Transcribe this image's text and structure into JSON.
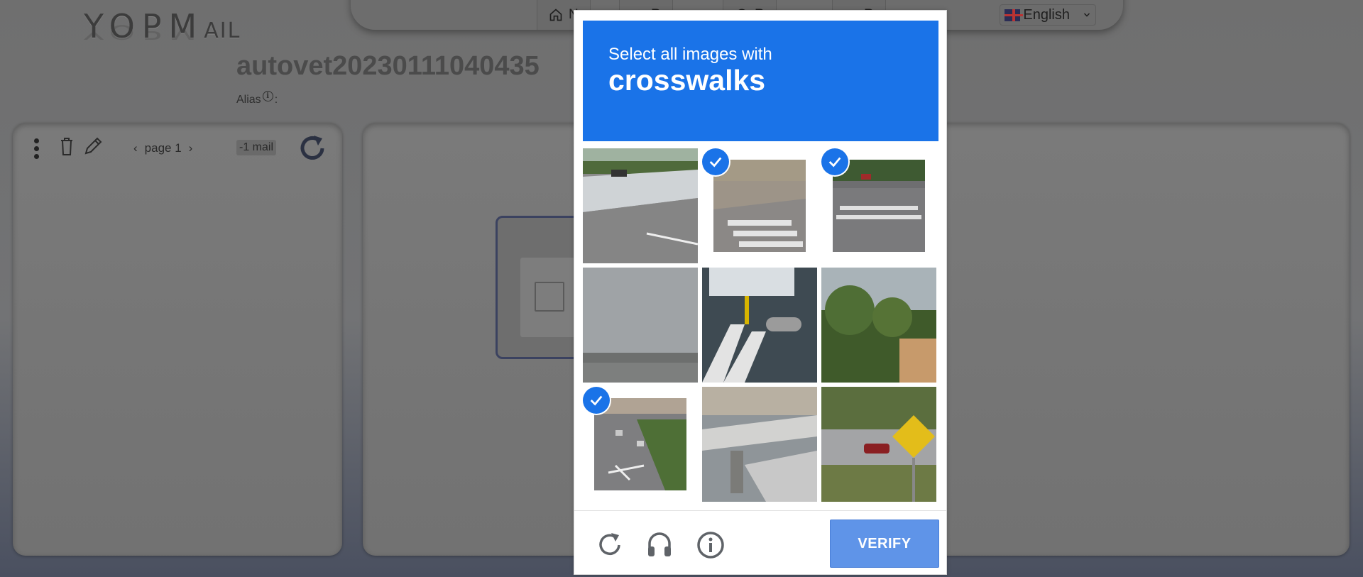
{
  "site": {
    "logo_main": "YOPM",
    "logo_tail": "AIL",
    "inbox_name": "autovet20230111040435",
    "alias_label": "Alias",
    "alias_sep": ":"
  },
  "nav": {
    "items": [
      {
        "label": "N",
        "icon": "home-icon"
      },
      {
        "label": "R",
        "icon": "back-icon"
      },
      {
        "label": "R",
        "icon": "globe-icon"
      },
      {
        "label": "R",
        "icon": "settings-icon"
      }
    ],
    "language": "English"
  },
  "inbox_toolbar": {
    "page_label": "page 1",
    "mail_count": "-1 mail"
  },
  "captcha": {
    "prompt": "Select all images with",
    "target": "crosswalks",
    "verify_label": "VERIFY",
    "accent_color": "#1a73e8",
    "tiles": [
      {
        "selected": false,
        "scene": "highway with wall"
      },
      {
        "selected": true,
        "scene": "crosswalk on road"
      },
      {
        "selected": true,
        "scene": "street with crosswalk"
      },
      {
        "selected": false,
        "scene": "cloudy sky"
      },
      {
        "selected": false,
        "scene": "crosswalk near bus"
      },
      {
        "selected": false,
        "scene": "palm trees"
      },
      {
        "selected": true,
        "scene": "road with traffic"
      },
      {
        "selected": false,
        "scene": "overpass"
      },
      {
        "selected": false,
        "scene": "road sign"
      }
    ]
  }
}
